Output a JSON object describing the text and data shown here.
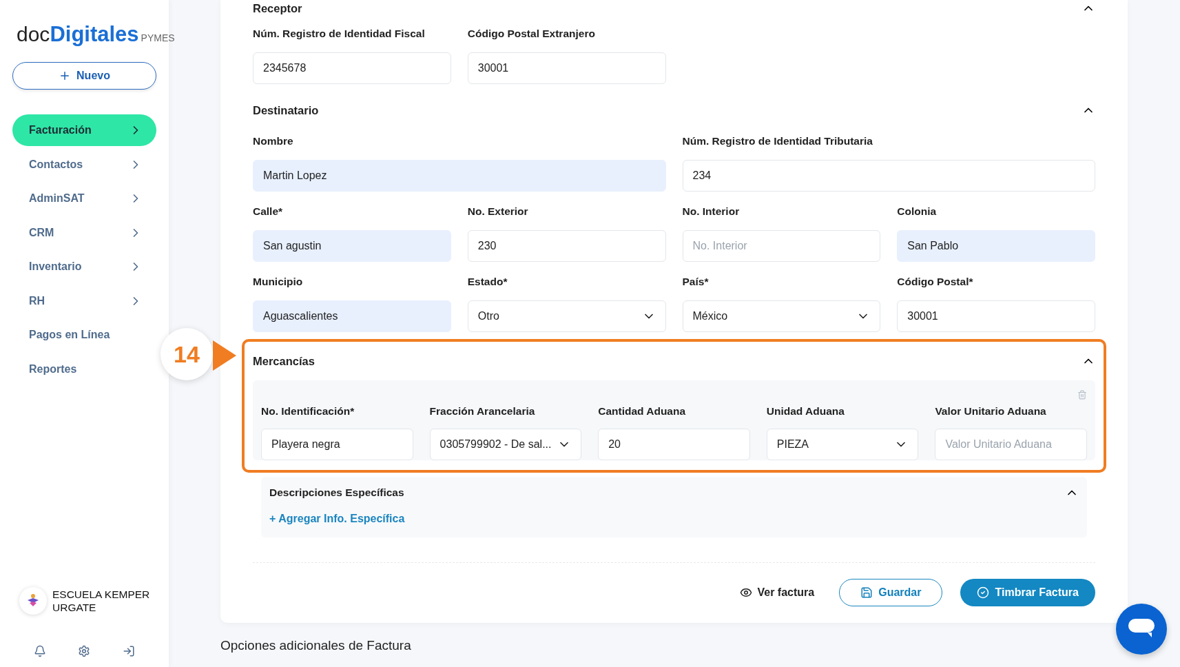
{
  "sidebar": {
    "logo": {
      "part_1": "doc",
      "part_2": "Digitales",
      "part_3": "PYMES"
    },
    "new_button": {
      "label": "Nuevo"
    },
    "items": [
      {
        "label": "Facturación",
        "selected": true,
        "has_arrow": true
      },
      {
        "label": "Contactos",
        "selected": false,
        "has_arrow": true
      },
      {
        "label": "AdminSAT",
        "selected": false,
        "has_arrow": true
      },
      {
        "label": "CRM",
        "selected": false,
        "has_arrow": true
      },
      {
        "label": "Inventario",
        "selected": false,
        "has_arrow": true
      },
      {
        "label": "RH",
        "selected": false,
        "has_arrow": true
      },
      {
        "label": "Pagos en Línea",
        "selected": false,
        "has_arrow": false
      },
      {
        "label": "Reportes",
        "selected": false,
        "has_arrow": false
      }
    ],
    "user": {
      "name": "ESCUELA KEMPER URGATE"
    }
  },
  "receptor": {
    "title": "Receptor",
    "fields": [
      {
        "label": "Núm. Registro de Identidad Fiscal",
        "value": "2345678",
        "kind": "text",
        "autofill": false
      },
      {
        "label": "Código Postal Extranjero",
        "value": "30001",
        "kind": "text",
        "autofill": false
      }
    ]
  },
  "destinatario": {
    "title": "Destinatario",
    "expanded": true,
    "name_fields": [
      {
        "label": "Nombre",
        "value": "Martin Lopez",
        "kind": "text",
        "autofill": true
      },
      {
        "label": "Núm. Registro de Identidad Tributaria",
        "value": "234",
        "kind": "text",
        "autofill": false
      }
    ],
    "rows": [
      [
        {
          "label": "Calle*",
          "value": "San agustin",
          "kind": "text",
          "autofill": true
        },
        {
          "label": "No. Exterior",
          "value": "230",
          "kind": "text",
          "autofill": false
        },
        {
          "label": "No. Interior",
          "placeholder": "No. Interior",
          "kind": "text",
          "autofill": false
        },
        {
          "label": "Colonia",
          "value": "San Pablo",
          "kind": "text",
          "autofill": true
        }
      ],
      [
        {
          "label": "Municipio",
          "value": "Aguascalientes",
          "kind": "text",
          "autofill": true
        },
        {
          "label": "Estado*",
          "value": "Otro",
          "kind": "select",
          "autofill": false
        },
        {
          "label": "País*",
          "value": "México",
          "kind": "select",
          "autofill": false
        },
        {
          "label": "Código Postal*",
          "value": "30001",
          "kind": "text",
          "autofill": false
        }
      ]
    ]
  },
  "mercancias": {
    "title": "Mercancías",
    "expanded": true,
    "highlighted": true,
    "fields": [
      {
        "label": "No. Identificación*",
        "value": "Playera negra",
        "kind": "text"
      },
      {
        "label": "Fracción Arancelaria",
        "value": "0305799902 - De sal...",
        "kind": "select"
      },
      {
        "label": "Cantidad Aduana",
        "value": "20",
        "kind": "text"
      },
      {
        "label": "Unidad Aduana",
        "value": "PIEZA",
        "kind": "select"
      },
      {
        "label": "Valor Unitario Aduana",
        "placeholder": "Valor Unitario Aduana",
        "kind": "text"
      }
    ],
    "descripciones": {
      "title": "Descripciones Específicas",
      "expanded": true,
      "link": "+ Agregar Info. Específica"
    }
  },
  "annotation": {
    "number": "14"
  },
  "actions": [
    {
      "label": "Ver factura",
      "kind": "plain"
    },
    {
      "label": "Guardar",
      "kind": "outline"
    },
    {
      "label": "Timbrar Factura",
      "kind": "primary"
    }
  ],
  "extra_title": "Opciones adicionales de Factura"
}
